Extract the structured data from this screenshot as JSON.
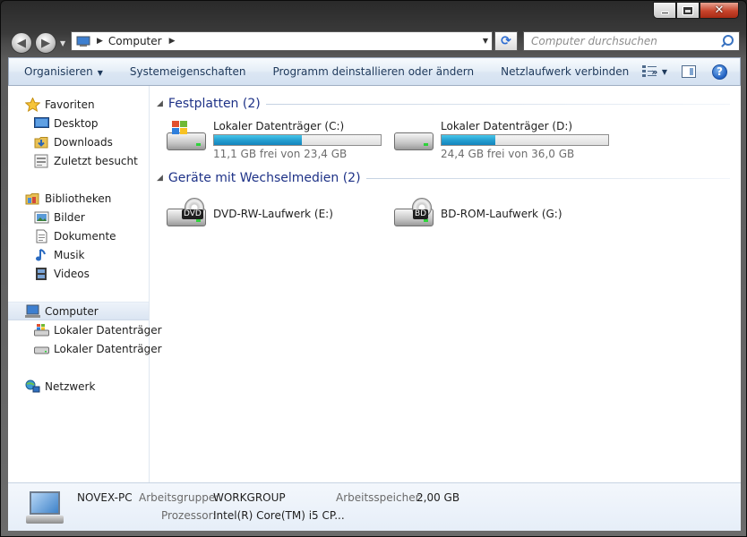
{
  "window": {
    "close_glyph": "✕"
  },
  "nav": {
    "back_glyph": "◀",
    "forward_glyph": "▶"
  },
  "address": {
    "segment": "Computer",
    "refresh_glyph": "⟳"
  },
  "search": {
    "placeholder": "Computer durchsuchen"
  },
  "toolbar": {
    "items": [
      {
        "label": "Organisieren",
        "has_dropdown": true
      },
      {
        "label": "Systemeigenschaften"
      },
      {
        "label": "Programm deinstallieren oder ändern"
      },
      {
        "label": "Netzlaufwerk verbinden"
      }
    ],
    "more": "»",
    "help": "?"
  },
  "sidebar": {
    "favorites": {
      "label": "Favoriten",
      "items": [
        {
          "label": "Desktop",
          "icon": "desktop-icon"
        },
        {
          "label": "Downloads",
          "icon": "downloads-folder-icon"
        },
        {
          "label": "Zuletzt besucht",
          "icon": "recent-places-icon"
        }
      ]
    },
    "libraries": {
      "label": "Bibliotheken",
      "items": [
        {
          "label": "Bilder",
          "icon": "pictures-icon"
        },
        {
          "label": "Dokumente",
          "icon": "documents-icon"
        },
        {
          "label": "Musik",
          "icon": "music-icon"
        },
        {
          "label": "Videos",
          "icon": "videos-icon"
        }
      ]
    },
    "computer": {
      "label": "Computer",
      "items": [
        {
          "label": "Lokaler Datenträger",
          "icon": "windows-drive-icon"
        },
        {
          "label": "Lokaler Datenträger",
          "icon": "hard-drive-icon"
        }
      ]
    },
    "network": {
      "label": "Netzwerk"
    }
  },
  "groups": {
    "hard_disks": {
      "title": "Festplatten (2)",
      "drives": [
        {
          "name": "Lokaler Datenträger (C:)",
          "free": "11,1 GB frei von 23,4 GB",
          "used_fraction": 0.526,
          "icon": "windows-drive-icon"
        },
        {
          "name": "Lokaler Datenträger (D:)",
          "free": "24,4 GB frei von 36,0 GB",
          "used_fraction": 0.322,
          "icon": "hard-drive-icon"
        }
      ]
    },
    "removable": {
      "title": "Geräte mit Wechselmedien (2)",
      "drives": [
        {
          "name": "DVD-RW-Laufwerk (E:)",
          "disc_label": "DVD",
          "icon": "dvd-drive-icon"
        },
        {
          "name": "BD-ROM-Laufwerk (G:)",
          "disc_label": "BD",
          "icon": "bd-drive-icon"
        }
      ]
    }
  },
  "details": {
    "computer_name": "NOVEX-PC",
    "workgroup_label": "Arbeitsgruppe:",
    "workgroup_value": "WORKGROUP",
    "memory_label": "Arbeitsspeicher:",
    "memory_value": "2,00 GB",
    "cpu_label": "Prozessor:",
    "cpu_value": "Intel(R) Core(TM) i5 CP..."
  },
  "colors": {
    "group_title": "#1e3287",
    "capacity_fill": "#26a0d1",
    "toolbar_text": "#1e395b"
  }
}
